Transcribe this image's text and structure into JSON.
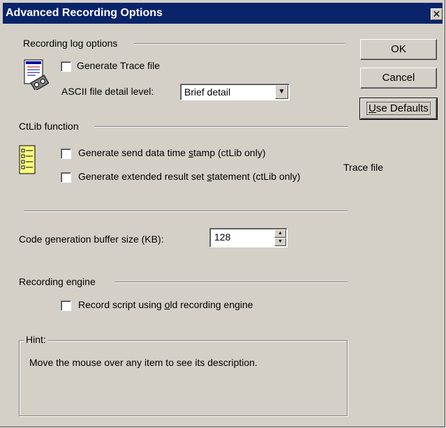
{
  "window": {
    "title": "Advanced Recording Options",
    "close_glyph": "✕"
  },
  "recording_log": {
    "group_label": "Recording log options",
    "generate_trace_label": "Generate  Trace file",
    "generate_trace_checked": false,
    "ascii_detail_label": "ASCII file detail level:",
    "ascii_detail_value": "Brief detail"
  },
  "ctlib": {
    "group_label": "CtLib function",
    "send_timestamp_pre": "Generate send data time ",
    "send_timestamp_ul": "s",
    "send_timestamp_post": "tamp (ctLib only)",
    "send_timestamp_checked": false,
    "extended_pre": "Generate extended result set ",
    "extended_ul": "s",
    "extended_post": "tatement (ctLib only)",
    "extended_checked": false,
    "side_text": "Trace file"
  },
  "buffer": {
    "label": "Code generation buffer size (KB):",
    "value": "128"
  },
  "engine": {
    "group_label": "Recording engine",
    "old_engine_pre": "Record script using ",
    "old_engine_ul": "o",
    "old_engine_post": "ld recording engine",
    "old_engine_checked": false
  },
  "hint": {
    "label": "Hint:",
    "text": "Move the mouse over any item to see its description."
  },
  "buttons": {
    "ok": "OK",
    "cancel": "Cancel",
    "use_defaults_ul": "U",
    "use_defaults_rest": "se Defaults"
  },
  "icons": {
    "log_icon": "document-with-tape-icon",
    "ctlib_icon": "checklist-document-icon"
  },
  "colors": {
    "face": "#d4d0c8",
    "titlebar": "#0a246a",
    "shadow": "#808080",
    "highlight": "#ffffff"
  }
}
